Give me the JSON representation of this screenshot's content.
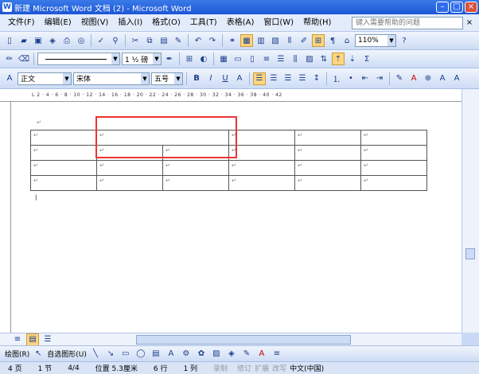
{
  "title": "新建 Microsoft Word 文档 (2) - Microsoft Word",
  "menu": [
    "文件(F)",
    "编辑(E)",
    "视图(V)",
    "插入(I)",
    "格式(O)",
    "工具(T)",
    "表格(A)",
    "窗口(W)",
    "帮助(H)"
  ],
  "help_placeholder": "键入需要帮助的问题",
  "zoom": "110%",
  "line_weight": "1 ½ 磅",
  "style": "正文",
  "font": "宋体",
  "size": "五号",
  "toolbar_symbols": {
    "bold": "B",
    "italic": "I",
    "underline": "U",
    "font_color": "A",
    "text_a": "A"
  },
  "ruler_text": "L  2 · 4 · 6 · 8 · 10 · 12 · 14 · 16 · 18 · 20 · 22 · 24 · 26 · 28 · 30 · 32 · 34 · 36 · 38 · 40 · 42",
  "paragraph_mark": "↵",
  "drawbar": {
    "draw": "绘图(R)",
    "autoshapes": "自选图形(U)"
  },
  "status": {
    "page": "4 页",
    "section": "1 节",
    "pages": "4/4",
    "position": "位置 5.3厘米",
    "line": "6 行",
    "col": "1 列",
    "rec": "录制",
    "trk": "修订",
    "ext": "扩展",
    "ovr": "改写",
    "lang": "中文(中国)"
  }
}
